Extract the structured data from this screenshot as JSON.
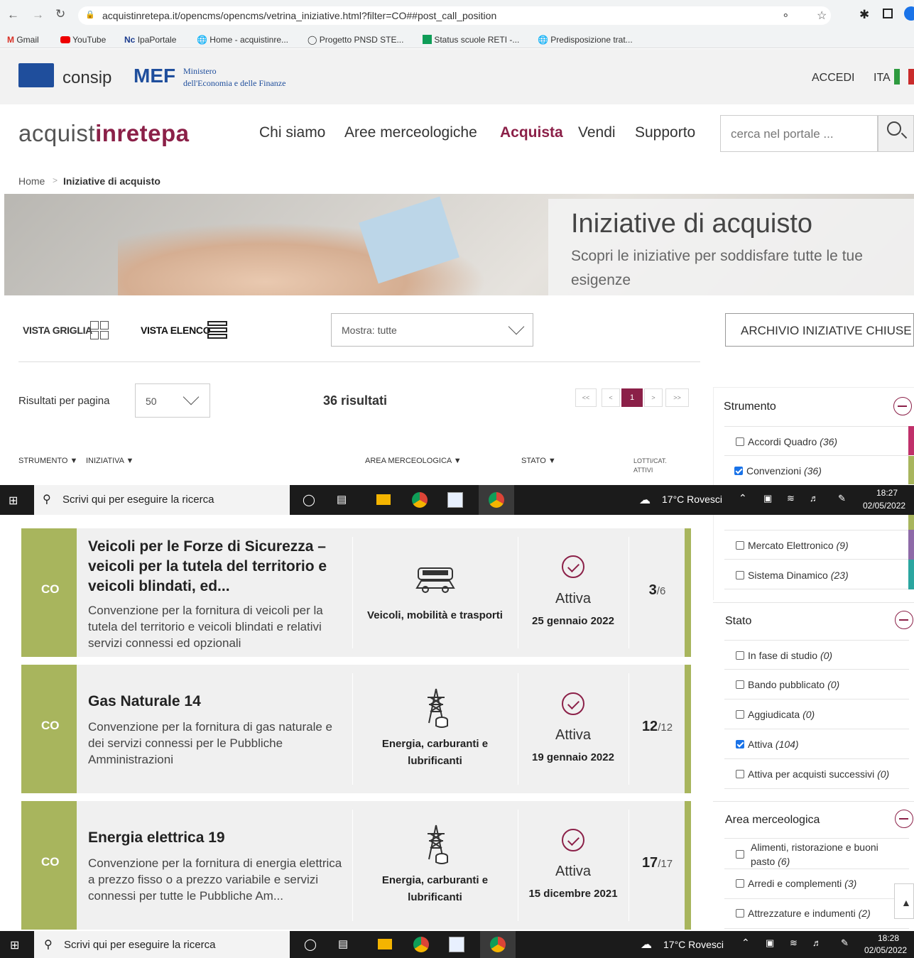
{
  "browser": {
    "url": "acquistinretepa.it/opencms/opencms/vetrina_iniziative.html?filter=CO##post_call_position",
    "bookmarks": [
      "Gmail",
      "YouTube",
      "IpaPortale",
      "Home - acquistinre...",
      "Progetto PNSD STE...",
      "Status scuole RETI -...",
      "Predisposizione trat..."
    ]
  },
  "header": {
    "consip": "consip",
    "mef": "MEF",
    "ministero_line1": "Ministero",
    "ministero_line2": "dell'Economia e delle Finanze",
    "login": "ACCEDI",
    "lang": "ITA"
  },
  "nav": {
    "logo_a": "acquist",
    "logo_b": "inrete",
    "logo_c": "pa",
    "items": [
      "Chi siamo",
      "Aree merceologiche",
      "Acquista",
      "Vendi",
      "Supporto"
    ],
    "search_placeholder": "cerca nel portale ..."
  },
  "breadcrumb": {
    "home": "Home",
    "sep": ">",
    "current": "Iniziative di acquisto"
  },
  "hero": {
    "title": "Iniziative di acquisto",
    "subtitle": "Scopri le iniziative per soddisfare tutte le tue esigenze"
  },
  "toolbar": {
    "grid_label": "VISTA GRIGLIA",
    "list_label": "VISTA ELENCO",
    "show_select": "Mostra: tutte",
    "archive_button": "ARCHIVIO INIZIATIVE CHIUSE"
  },
  "results": {
    "per_page_label": "Risultati per pagina",
    "per_page_value": "50",
    "count": "36 risultati",
    "pagination": [
      "<<",
      "<",
      "1",
      ">",
      ">>"
    ]
  },
  "columns": {
    "strumento": "STRUMENTO",
    "iniziativa": "INIZIATIVA",
    "area": "AREA MERCEOLOGICA",
    "stato": "STATO",
    "lotti_1": "LOTTI/CAT.",
    "lotti_2": "ATTIVI"
  },
  "rows": [
    {
      "badge": "CO",
      "title": "Veicoli per le Forze di Sicurezza – veicoli per la tutela del territorio e veicoli blindati, ed...",
      "desc": "Convenzione per la fornitura di veicoli per la tutela del territorio e veicoli blindati e relativi servizi connessi ed opzionali",
      "area": "Veicoli, mobilità e trasporti",
      "icon": "vehicle-icon",
      "status": "Attiva",
      "date": "25 gennaio 2022",
      "lotti_active": "3",
      "lotti_total": "/6"
    },
    {
      "badge": "CO",
      "title": "Gas Naturale 14",
      "desc": "Convenzione per la fornitura di gas naturale e dei servizi connessi per le Pubbliche Amministrazioni",
      "area": "Energia, carburanti e lubrificanti",
      "icon": "energy-tower-icon",
      "status": "Attiva",
      "date": "19 gennaio 2022",
      "lotti_active": "12",
      "lotti_total": "/12"
    },
    {
      "badge": "CO",
      "title": "Energia elettrica 19",
      "desc": "Convenzione per la fornitura di energia elettrica a prezzo fisso o a prezzo variabile e servizi connessi per tutte le Pubbliche Am...",
      "area": "Energia, carburanti e lubrificanti",
      "icon": "energy-tower-icon",
      "status": "Attiva",
      "date": "15 dicembre 2021",
      "lotti_active": "17",
      "lotti_total": "/17"
    }
  ],
  "filters": {
    "strumento": {
      "title": "Strumento",
      "items": [
        {
          "label": "Accordi Quadro",
          "count": "(36)",
          "checked": false
        },
        {
          "label": "Convenzioni",
          "count": "(36)",
          "checked": true
        },
        {
          "label": "Mercato Elettronico",
          "count": "(9)",
          "checked": false
        },
        {
          "label": "Sistema Dinamico",
          "count": "(23)",
          "checked": false
        }
      ]
    },
    "stato": {
      "title": "Stato",
      "items": [
        {
          "label": "In fase di studio",
          "count": "(0)",
          "checked": false
        },
        {
          "label": "Bando pubblicato",
          "count": "(0)",
          "checked": false
        },
        {
          "label": "Aggiudicata",
          "count": "(0)",
          "checked": false
        },
        {
          "label": "Attiva",
          "count": "(104)",
          "checked": true
        },
        {
          "label": "Attiva per acquisti successivi",
          "count": "(0)",
          "checked": false
        }
      ]
    },
    "area": {
      "title": "Area merceologica",
      "items": [
        {
          "label": "Alimenti, ristorazione e buoni pasto",
          "count": "(6)",
          "checked": false
        },
        {
          "label": "Arredi e complementi",
          "count": "(3)",
          "checked": false
        },
        {
          "label": "Attrezzature e indumenti",
          "count": "(2)",
          "checked": false
        }
      ]
    }
  },
  "taskbar_top": {
    "search": "Scrivi qui per eseguire la ricerca",
    "weather": "17°C Rovesci",
    "time": "18:27",
    "date": "02/05/2022"
  },
  "taskbar_bottom": {
    "search": "Scrivi qui per eseguire la ricerca",
    "weather": "17°C Rovesci",
    "time": "18:28",
    "date": "02/05/2022"
  },
  "colors": {
    "accent": "#8b2048",
    "co_green": "#a8b55d",
    "accordi": "#c0306a",
    "mercato": "#8e6aa8",
    "sistema": "#2ba6a0"
  }
}
